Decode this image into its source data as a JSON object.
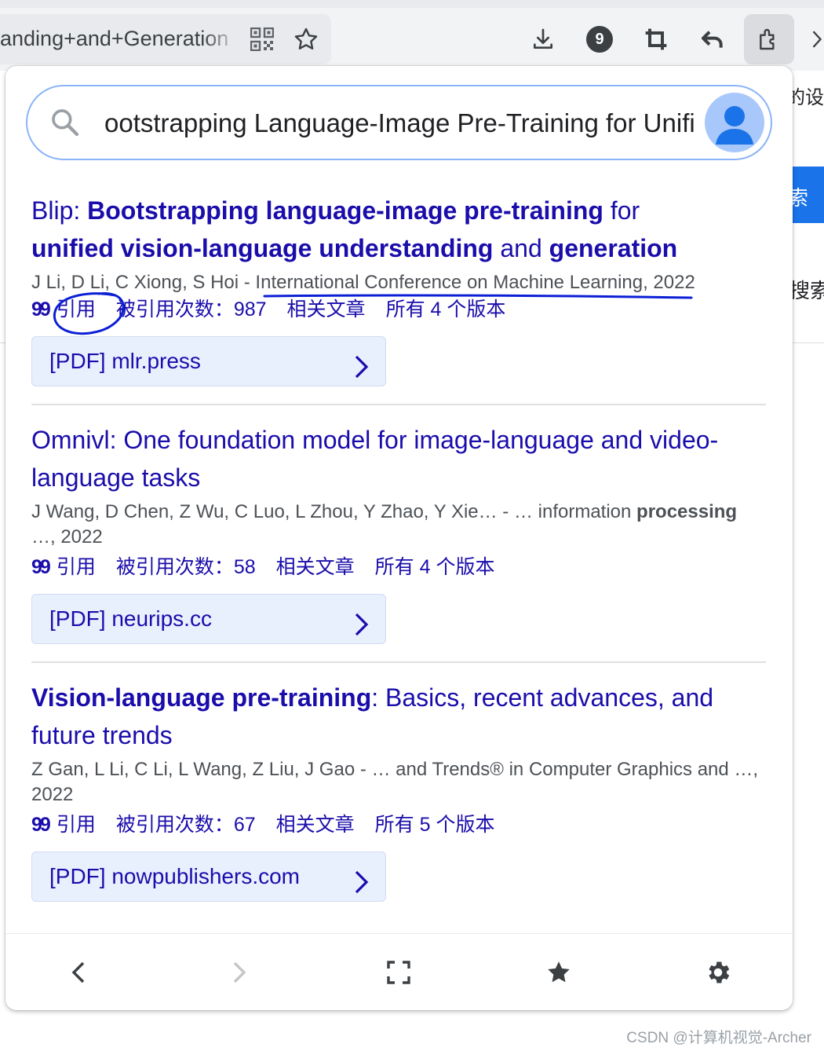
{
  "browser": {
    "url_text": "anding+and+Generation",
    "extension_badge": "9",
    "right_chrome_char": "",
    "page_peek_top": "的设备",
    "page_peek_mid": "搜索",
    "page_peek_btn": "索"
  },
  "search": {
    "query": "ootstrapping Language-Image Pre-Training for Unified Vision-Language Understanding and Generation"
  },
  "results": [
    {
      "title_parts": [
        {
          "t": "Blip: ",
          "b": false
        },
        {
          "t": "Bootstrapping language-image pre-training",
          "b": true
        },
        {
          "t": " for ",
          "b": false
        },
        {
          "t": "unified vision-language understanding",
          "b": true
        },
        {
          "t": " and ",
          "b": false
        },
        {
          "t": "generation",
          "b": true
        }
      ],
      "meta_line1": "J Li, D Li, C Xiong, S Hoi - International Conference on Machine Learning, 2022",
      "meta_bold": "",
      "meta_rest": "",
      "cite": "引用",
      "cited_by": "被引用次数：987",
      "related": "相关文章",
      "versions": "所有 4 个版本",
      "pdf": "[PDF] mlr.press"
    },
    {
      "title_parts": [
        {
          "t": "Omnivl: One foundation model for image-language and video-language tasks",
          "b": false
        }
      ],
      "meta_line1": "J Wang, D Chen, Z Wu, C Luo, L Zhou, Y Zhao, Y Xie… - … information ",
      "meta_bold": "processing",
      "meta_rest": " …, 2022",
      "cite": "引用",
      "cited_by": "被引用次数：58",
      "related": "相关文章",
      "versions": "所有 4 个版本",
      "pdf": "[PDF] neurips.cc"
    },
    {
      "title_parts": [
        {
          "t": "Vision-language pre-training",
          "b": true
        },
        {
          "t": ": Basics, recent advances, and future trends",
          "b": false
        }
      ],
      "meta_line1": "Z Gan, L Li, C Li, L Wang, Z Liu, J Gao - … and Trends® in Computer Graphics and …, 2022",
      "meta_bold": "",
      "meta_rest": "",
      "cite": "引用",
      "cited_by": "被引用次数：67",
      "related": "相关文章",
      "versions": "所有 5 个版本",
      "pdf": "[PDF] nowpublishers.com"
    }
  ],
  "watermark": "CSDN @计算机视觉-Archer",
  "colors": {
    "link": "#1a0dab",
    "annotation": "#0b1fd6",
    "pdf_bg": "#e8f0fe",
    "search_border": "#8ab4f8"
  }
}
